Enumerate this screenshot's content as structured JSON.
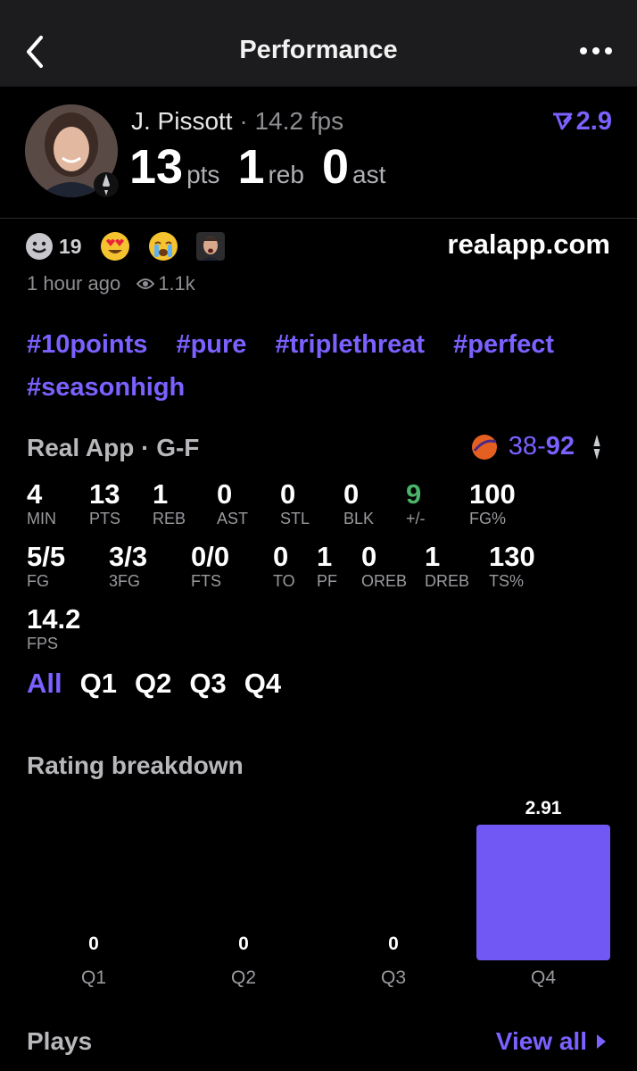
{
  "header": {
    "title": "Performance"
  },
  "player": {
    "name": "J. Pissott",
    "separator": "·",
    "fps": "14.2 fps",
    "pts": "13",
    "pts_unit": "pts",
    "reb": "1",
    "reb_unit": "reb",
    "ast": "0",
    "ast_unit": "ast",
    "rating": "2.9"
  },
  "reactions": {
    "smiley_count": "19"
  },
  "site": "realapp.com",
  "meta": {
    "time": "1 hour ago",
    "views": "1.1k"
  },
  "hashtags": [
    "#10points",
    "#pure",
    "#triplethreat",
    "#perfect",
    "#seasonhigh"
  ],
  "game": {
    "source": "Real App · G-F",
    "score_left": "38",
    "dash": "-",
    "score_right": "92"
  },
  "stats_row1": [
    {
      "v": "4",
      "l": "MIN"
    },
    {
      "v": "13",
      "l": "PTS"
    },
    {
      "v": "1",
      "l": "REB"
    },
    {
      "v": "0",
      "l": "AST"
    },
    {
      "v": "0",
      "l": "STL"
    },
    {
      "v": "0",
      "l": "BLK"
    },
    {
      "v": "9",
      "l": "+/-"
    },
    {
      "v": "100",
      "l": "FG%"
    }
  ],
  "stats_row2": [
    {
      "v": "5/5",
      "l": "FG"
    },
    {
      "v": "3/3",
      "l": "3FG"
    },
    {
      "v": "0/0",
      "l": "FTS"
    },
    {
      "v": "0",
      "l": "TO"
    },
    {
      "v": "1",
      "l": "PF"
    },
    {
      "v": "0",
      "l": "OREB"
    },
    {
      "v": "1",
      "l": "DREB"
    },
    {
      "v": "130",
      "l": "TS%"
    }
  ],
  "stats_row3": [
    {
      "v": "14.2",
      "l": "FPS"
    }
  ],
  "quarter_tabs": [
    "All",
    "Q1",
    "Q2",
    "Q3",
    "Q4"
  ],
  "breakdown_title": "Rating breakdown",
  "chart_data": {
    "type": "bar",
    "categories": [
      "Q1",
      "Q2",
      "Q3",
      "Q4"
    ],
    "values": [
      0,
      0,
      0,
      2.91
    ],
    "data_labels": [
      "0",
      "0",
      "0",
      "2.91"
    ],
    "ylim": [
      0,
      2.91
    ],
    "color": "#7158f5"
  },
  "plays": {
    "title": "Plays",
    "view_all": "View all"
  },
  "colors": {
    "accent": "#7b61ff",
    "positive": "#4cb36a",
    "background": "#000000"
  }
}
